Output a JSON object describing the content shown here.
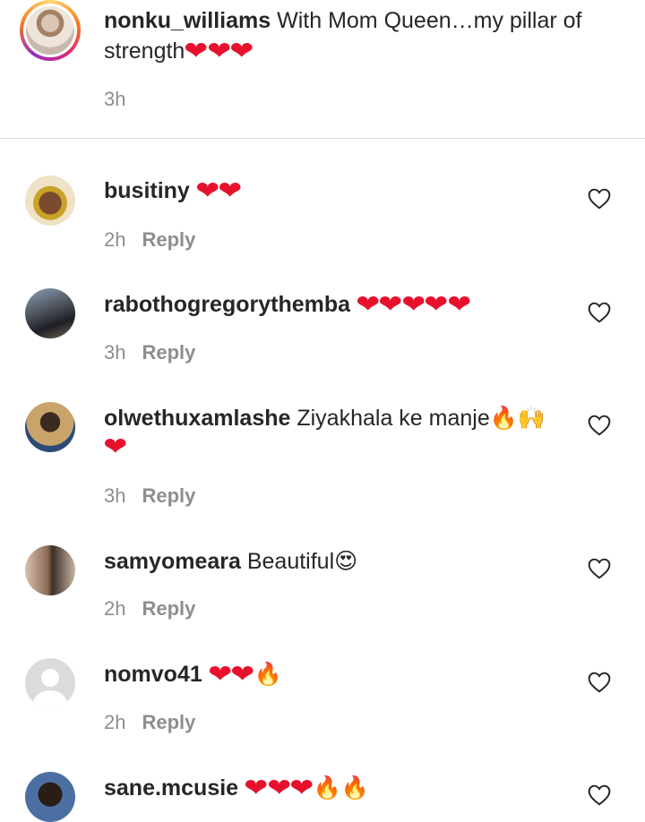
{
  "caption": {
    "username": "nonku_williams",
    "text_line1": " With Mom Queen…my pillar of",
    "text_line2": "strength",
    "time": "3h"
  },
  "comments": [
    {
      "username": "busitiny",
      "text": "",
      "time": "2h",
      "reply": "Reply"
    },
    {
      "username": "rabothogregorythemba",
      "text": "",
      "time": "3h",
      "reply": "Reply"
    },
    {
      "username": "olwethuxamlashe",
      "text": " Ziyakhala ke manje",
      "time": "3h",
      "reply": "Reply"
    },
    {
      "username": "samyomeara",
      "text": " Beautiful",
      "time": "2h",
      "reply": "Reply"
    },
    {
      "username": "nomvo41",
      "text": "",
      "time": "2h",
      "reply": "Reply"
    },
    {
      "username": "sane.mcusie",
      "text": "",
      "time": "",
      "reply": ""
    }
  ],
  "icons": {
    "heart_emoji": "red-heart-emoji",
    "fire_emoji": "fire-emoji",
    "like": "heart-outline-icon"
  },
  "colors": {
    "heart": "#e8112d",
    "muted": "#8e8e8e",
    "divider": "#dbdbdb"
  }
}
